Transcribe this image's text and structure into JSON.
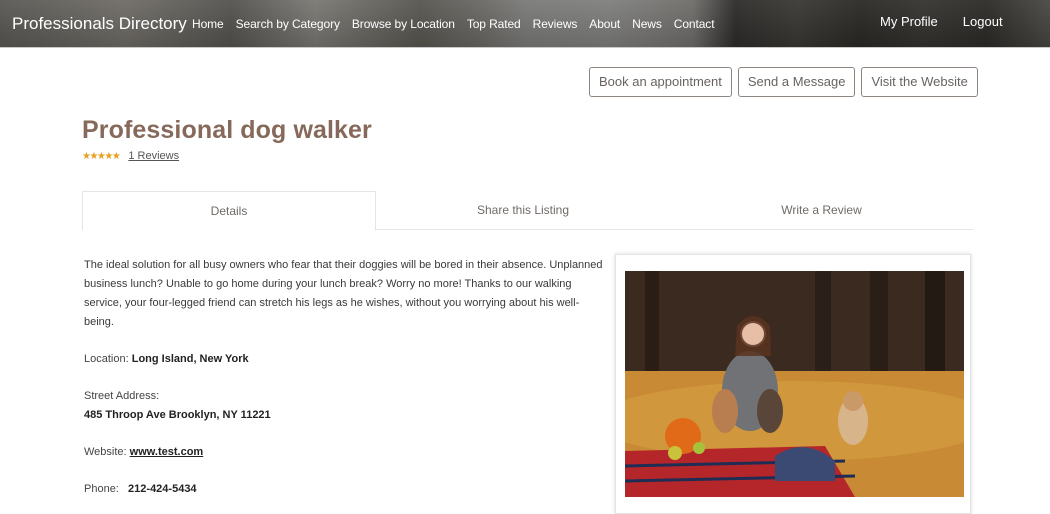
{
  "header": {
    "brand": "Professionals Directory",
    "nav": [
      "Home",
      "Search by Category",
      "Browse by Location",
      "Top Rated",
      "Reviews",
      "About",
      "News",
      "Contact"
    ],
    "nav_right": [
      "My Profile",
      "Logout"
    ]
  },
  "actions": {
    "book": "Book an appointment",
    "message": "Send a Message",
    "website": "Visit the Website"
  },
  "listing": {
    "title": "Professional dog walker",
    "stars": "★★★★★",
    "rating": 5,
    "reviews_link": "1 Reviews"
  },
  "tabs": [
    {
      "label": "Details",
      "active": true
    },
    {
      "label": "Share this Listing",
      "active": false
    },
    {
      "label": "Write a Review",
      "active": false
    }
  ],
  "details": {
    "description": "The ideal solution for all busy owners who fear that their doggies will be bored in their absence. Unplanned business lunch? Unable to go home during your lunch break? Worry no more! Thanks to our walking service, your four-legged friend can stretch his legs as he wishes, without you worrying about his well-being.",
    "location_label": "Location:",
    "location_value": "Long Island, New York",
    "street_label": "Street Address:",
    "street_value": "485 Throop Ave Brooklyn, NY 11221",
    "website_label": "Website:",
    "website_value": "www.test.com",
    "phone_label": "Phone:",
    "phone_value": "212-424-5434"
  },
  "photo": {
    "alt": "Woman sitting on a plaid blanket in autumn leaves with three corgi dogs and a pumpkin"
  }
}
